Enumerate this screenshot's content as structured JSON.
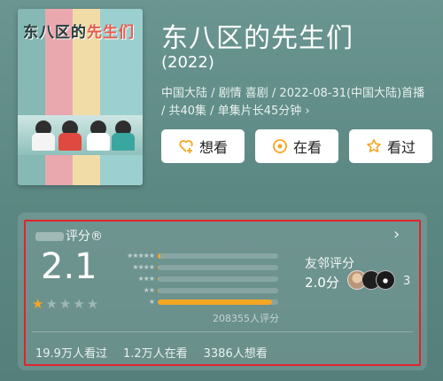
{
  "poster": {
    "title_part1": "东八区的",
    "title_part2": "先生们"
  },
  "movie": {
    "title": "东八区的先生们",
    "year": "(2022)",
    "meta_line": "中国大陆 / 剧情 喜剧 / 2022-08-31(中国大陆)首播 / 共40集 / 单集片长45分钟 ›"
  },
  "actions": [
    {
      "label": "想看",
      "icon": "heart-plus-icon"
    },
    {
      "label": "在看",
      "icon": "target-icon"
    },
    {
      "label": "看过",
      "icon": "star-outline-icon"
    }
  ],
  "rating": {
    "label_suffix": "评分®",
    "score": "2.1",
    "stars_filled": 1,
    "stars_total": 5,
    "distribution": [
      {
        "stars": "★★★★★",
        "fraction": 0.02
      },
      {
        "stars": "★★★★",
        "fraction": 0.01
      },
      {
        "stars": "★★★",
        "fraction": 0.01
      },
      {
        "stars": "★★",
        "fraction": 0.01
      },
      {
        "stars": "★",
        "fraction": 0.95
      }
    ],
    "count_text": "208355人评分"
  },
  "friends": {
    "label": "友邻评分",
    "score": "2.0分",
    "count": "3"
  },
  "stats": {
    "watched": "19.9万人看过",
    "watching": "1.2万人在看",
    "want": "3386人想看"
  },
  "colors": {
    "accent": "#f5a623",
    "highlight_border": "#e0242a",
    "background": "#5e8a86"
  }
}
